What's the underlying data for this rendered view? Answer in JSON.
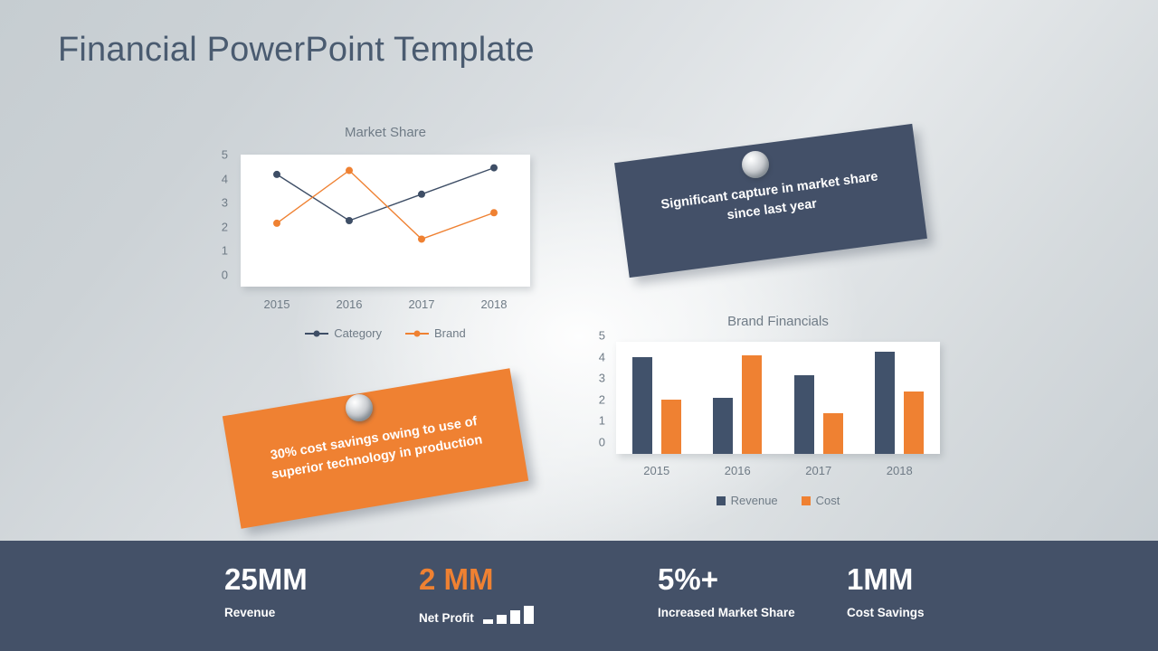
{
  "slide": {
    "title": "Financial PowerPoint Template",
    "colors": {
      "brand_dark": "#435068",
      "brand_orange": "#ef8132",
      "background_light": "#e7eaec",
      "background_edge": "#c6cdd1",
      "text_muted": "#6f7b86"
    }
  },
  "notes": [
    {
      "id": "market-share-note",
      "text": "Significant capture in market share since last year",
      "color": "#435068",
      "pin_icon": "pin-icon"
    },
    {
      "id": "cost-savings-note",
      "text": "30% cost savings owing to use of superior technology in production",
      "color": "#ef8132",
      "pin_icon": "pin-icon"
    }
  ],
  "chart_data": [
    {
      "id": "market-share-chart",
      "type": "line",
      "title": "Market Share",
      "categories": [
        "2015",
        "2016",
        "2017",
        "2018"
      ],
      "series": [
        {
          "name": "Category",
          "values": [
            4.25,
            2.5,
            3.5,
            4.5
          ],
          "color": "#3e4e66"
        },
        {
          "name": "Brand",
          "values": [
            2.4,
            4.4,
            1.8,
            2.8
          ],
          "color": "#ef8132"
        }
      ],
      "yticks": [
        "5",
        "4",
        "3",
        "2",
        "1",
        "0"
      ],
      "ylim": [
        0,
        5
      ],
      "xlabel": "",
      "ylabel": "",
      "grid": false,
      "legend": "bottom",
      "marker": "circle"
    },
    {
      "id": "brand-financials-chart",
      "type": "bar",
      "title": "Brand Financials",
      "categories": [
        "2015",
        "2016",
        "2017",
        "2018"
      ],
      "series": [
        {
          "name": "Revenue",
          "values": [
            4.3,
            2.5,
            3.5,
            4.55
          ],
          "color": "#41526b"
        },
        {
          "name": "Cost",
          "values": [
            2.4,
            4.4,
            1.8,
            2.8
          ],
          "color": "#ef8132"
        }
      ],
      "yticks": [
        "5",
        "4",
        "3",
        "2",
        "1",
        "0"
      ],
      "ylim": [
        0,
        5
      ],
      "xlabel": "",
      "ylabel": "",
      "grid": false,
      "legend": "bottom",
      "marker": "square"
    }
  ],
  "kpis": [
    {
      "value": "25MM",
      "label": "Revenue",
      "accent": false,
      "icon": null
    },
    {
      "value": "2 MM",
      "label": "Net Profit",
      "accent": true,
      "icon": "growth-bars-icon"
    },
    {
      "value": "5%+",
      "label": "Increased Market Share",
      "accent": false,
      "icon": null
    },
    {
      "value": "1MM",
      "label": "Cost Savings",
      "accent": false,
      "icon": null
    }
  ]
}
